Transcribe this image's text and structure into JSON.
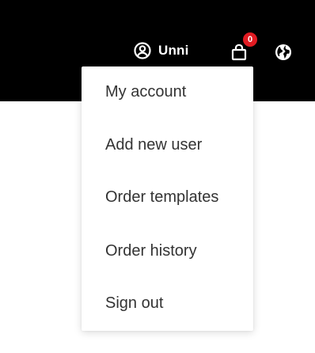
{
  "header": {
    "user_name": "Unni",
    "cart_count": "0",
    "icons": {
      "user": "user-circle-icon",
      "cart": "shopping-bag-icon",
      "language": "globe-icon"
    },
    "colors": {
      "background": "#000000",
      "badge": "#e11b22",
      "text": "#ffffff"
    }
  },
  "account_menu": {
    "items": [
      {
        "label": "My account"
      },
      {
        "label": "Add new user"
      },
      {
        "label": "Order templates"
      },
      {
        "label": "Order history"
      },
      {
        "label": "Sign out"
      }
    ]
  }
}
